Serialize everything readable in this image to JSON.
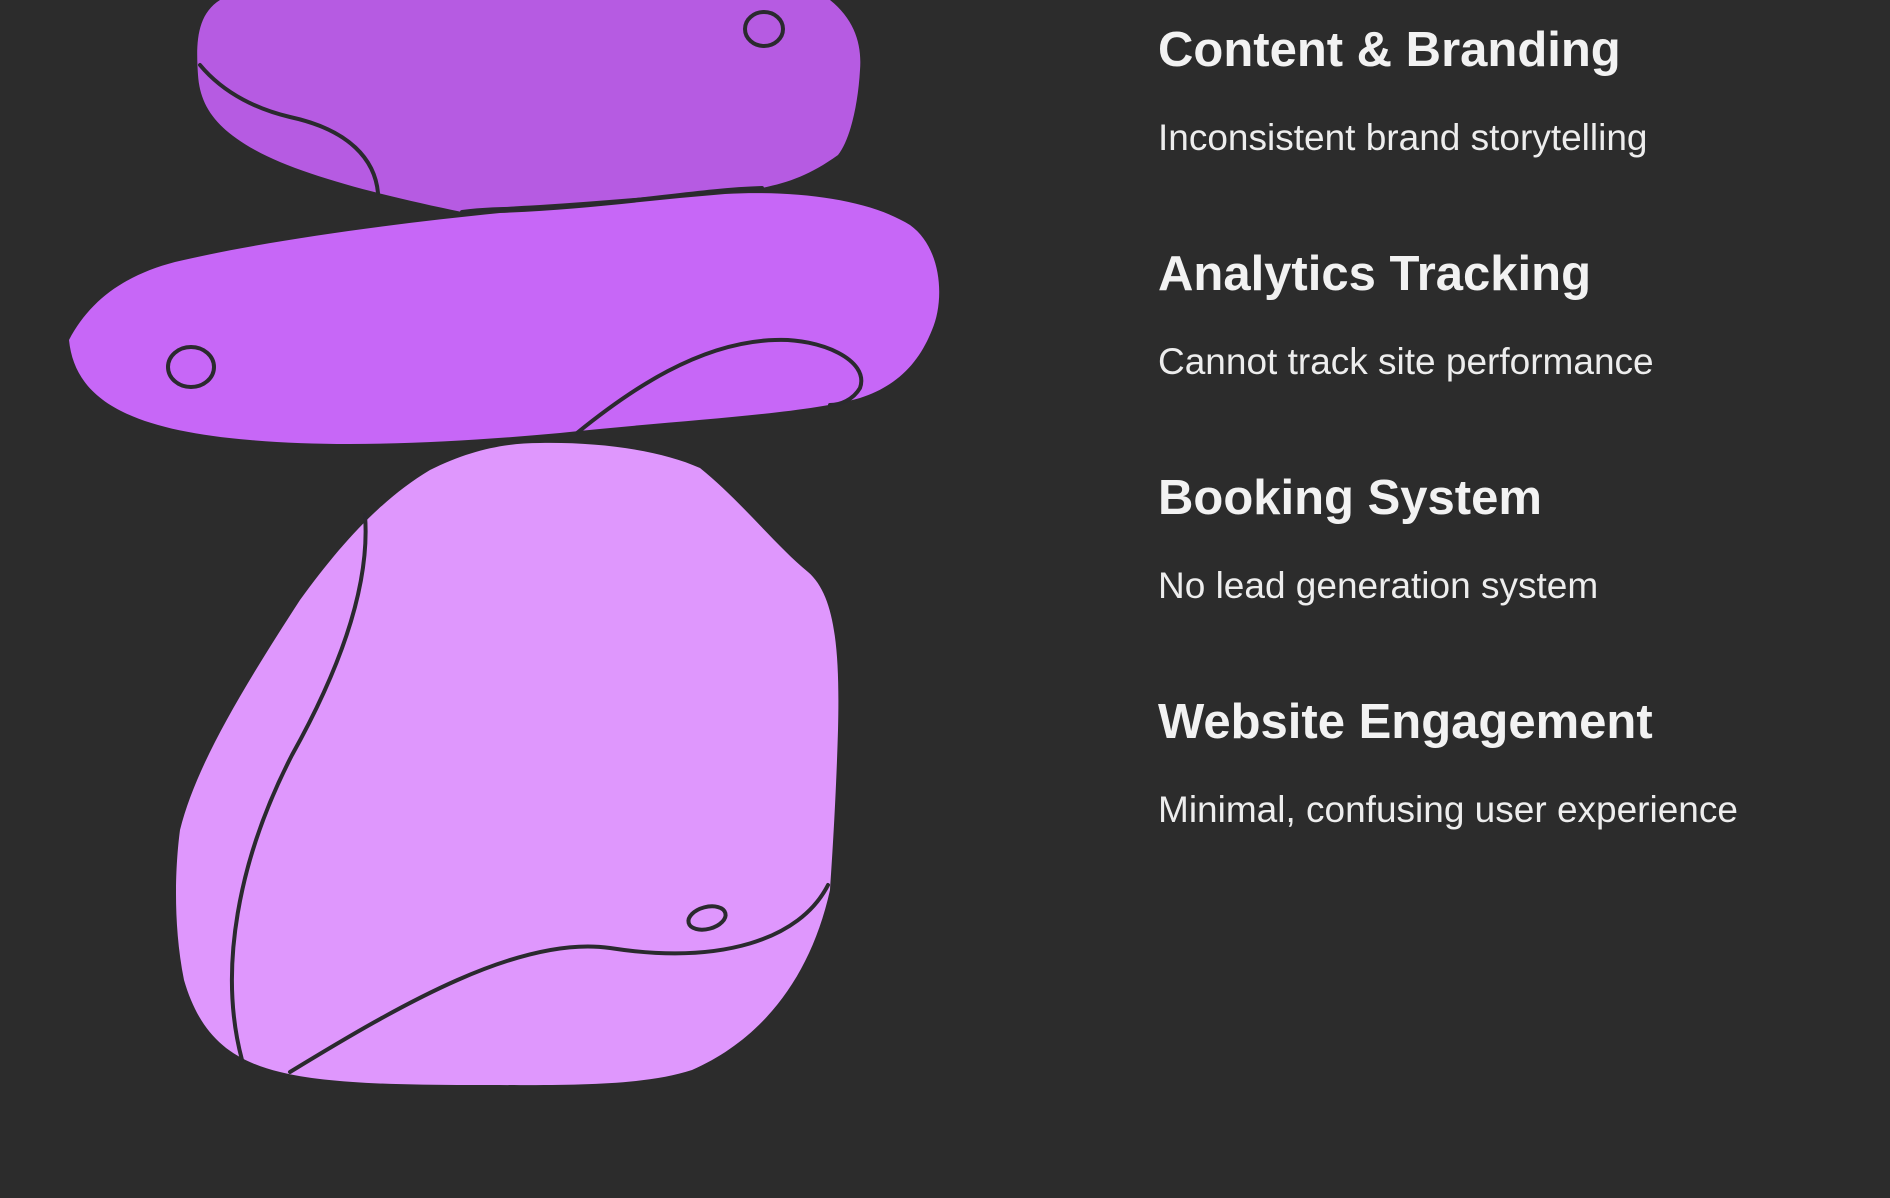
{
  "colors": {
    "background": "#2c2c2c",
    "stone_top": "#b65be2",
    "stone_middle": "#c767f7",
    "stone_bottom": "#df97fd",
    "outline": "#2a2a2e",
    "text": "#f2f2f2"
  },
  "items": [
    {
      "title": "Content & Branding",
      "description": "Inconsistent brand storytelling"
    },
    {
      "title": "Analytics Tracking",
      "description": "Cannot track site performance"
    },
    {
      "title": "Booking System",
      "description": "No lead generation system"
    },
    {
      "title": "Website Engagement",
      "description": "Minimal, confusing user experience"
    }
  ]
}
